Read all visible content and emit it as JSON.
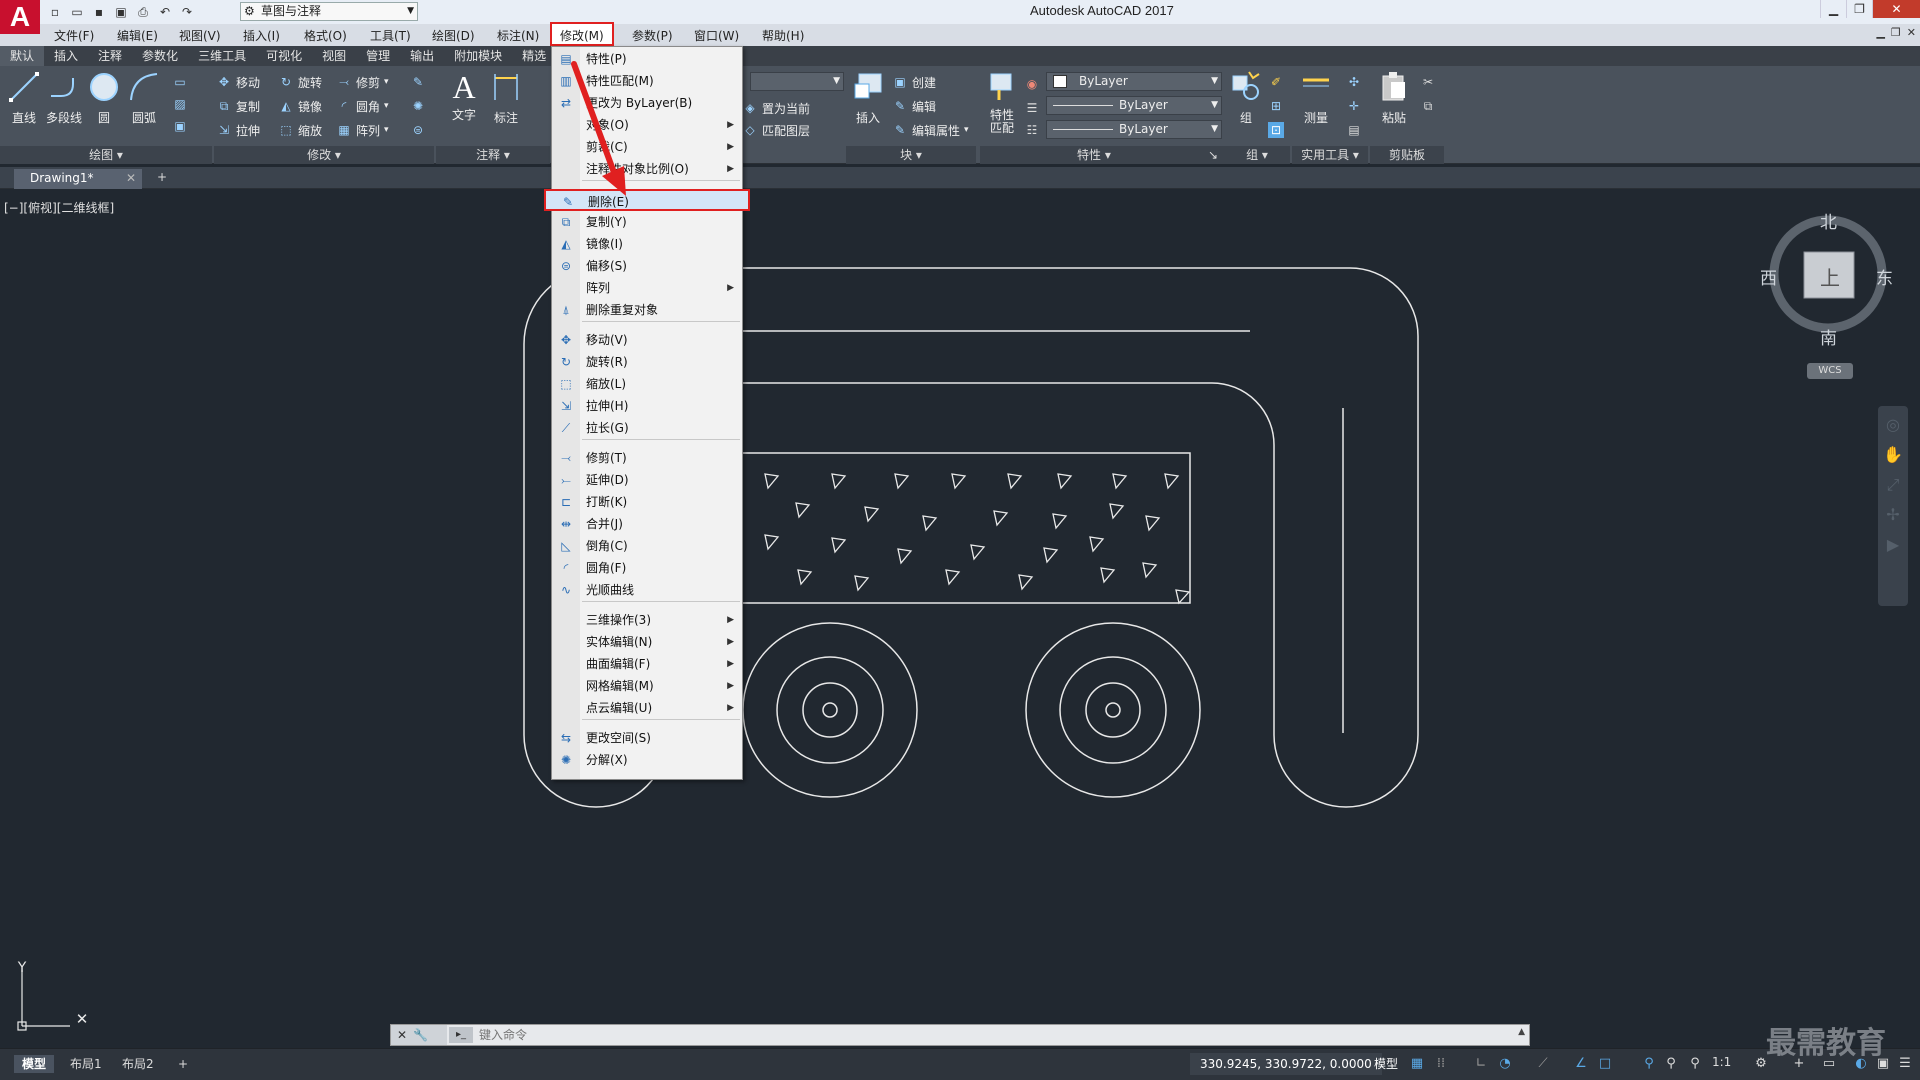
{
  "titlebar": {
    "app_title": "Autodesk AutoCAD 2017",
    "workspace": "草图与注释",
    "logo": "A"
  },
  "menubar": {
    "items": [
      "文件(F)",
      "编辑(E)",
      "视图(V)",
      "插入(I)",
      "格式(O)",
      "工具(T)",
      "绘图(D)",
      "标注(N)",
      "修改(M)",
      "参数(P)",
      "窗口(W)",
      "帮助(H)"
    ]
  },
  "ribbon_tabs": [
    "默认",
    "插入",
    "注释",
    "参数化",
    "三维工具",
    "可视化",
    "视图",
    "管理",
    "输出",
    "附加模块",
    "精选"
  ],
  "ribbon": {
    "draw": {
      "line": "直线",
      "polyline": "多段线",
      "circle": "圆",
      "arc": "圆弧",
      "title": "绘图"
    },
    "modify": {
      "move": "移动",
      "rotate": "旋转",
      "trim": "修剪",
      "copy": "复制",
      "mirror": "镜像",
      "fillet": "圆角",
      "stretch": "拉伸",
      "scale": "缩放",
      "array": "阵列",
      "title": "修改"
    },
    "annotation": {
      "text": "文字",
      "dimension": "标注",
      "title": "注释"
    },
    "layers": {
      "set_current": "置为当前",
      "match_layer": "匹配图层"
    },
    "block": {
      "insert": "插入",
      "create": "创建",
      "edit": "编辑",
      "edit_attr": "编辑属性",
      "title": "块"
    },
    "properties": {
      "match": "特性\n匹配",
      "color": "ByLayer",
      "linetype": "ByLayer",
      "lineweight": "ByLayer",
      "title": "特性"
    },
    "groups": {
      "group": "组",
      "title": "组"
    },
    "utilities": {
      "measure": "测量",
      "title": "实用工具"
    },
    "clipboard": {
      "paste": "粘贴",
      "title": "剪贴板"
    }
  },
  "doc_tab": {
    "name": "Drawing1*"
  },
  "viewport_label": "[−][俯视][二维线框]",
  "viewcube": {
    "north": "北",
    "south": "南",
    "east": "东",
    "west": "西",
    "top": "上",
    "wcs": "WCS"
  },
  "modify_menu": {
    "items": [
      {
        "label": "特性(P)",
        "icon": "properties-icon"
      },
      {
        "label": "特性匹配(M)",
        "icon": "match-properties-icon"
      },
      {
        "label": "更改为 ByLayer(B)",
        "icon": "bylayer-icon"
      },
      {
        "label": "对象(O)",
        "submenu": true
      },
      {
        "label": "剪裁(C)",
        "submenu": true
      },
      {
        "label": "注释性对象比例(O)",
        "submenu": true
      },
      {
        "label": "删除(E)",
        "icon": "erase-icon"
      },
      {
        "label": "复制(Y)",
        "icon": "copy-icon"
      },
      {
        "label": "镜像(I)",
        "icon": "mirror-icon"
      },
      {
        "label": "偏移(S)",
        "icon": "offset-icon"
      },
      {
        "label": "阵列",
        "submenu": true
      },
      {
        "label": "删除重复对象",
        "icon": "overkill-icon"
      },
      {
        "label": "移动(V)",
        "icon": "move-icon"
      },
      {
        "label": "旋转(R)",
        "icon": "rotate-icon"
      },
      {
        "label": "缩放(L)",
        "icon": "scale-icon"
      },
      {
        "label": "拉伸(H)",
        "icon": "stretch-icon"
      },
      {
        "label": "拉长(G)",
        "icon": "lengthen-icon"
      },
      {
        "label": "修剪(T)",
        "icon": "trim-icon"
      },
      {
        "label": "延伸(D)",
        "icon": "extend-icon"
      },
      {
        "label": "打断(K)",
        "icon": "break-icon"
      },
      {
        "label": "合并(J)",
        "icon": "join-icon"
      },
      {
        "label": "倒角(C)",
        "icon": "chamfer-icon"
      },
      {
        "label": "圆角(F)",
        "icon": "fillet-icon"
      },
      {
        "label": "光顺曲线",
        "icon": "blend-icon"
      },
      {
        "label": "三维操作(3)",
        "submenu": true
      },
      {
        "label": "实体编辑(N)",
        "submenu": true
      },
      {
        "label": "曲面编辑(F)",
        "submenu": true
      },
      {
        "label": "网格编辑(M)",
        "submenu": true
      },
      {
        "label": "点云编辑(U)",
        "submenu": true
      },
      {
        "label": "更改空间(S)",
        "icon": "change-space-icon"
      },
      {
        "label": "分解(X)",
        "icon": "explode-icon"
      }
    ],
    "highlighted": "删除(E)"
  },
  "command_line": {
    "placeholder": "键入命令"
  },
  "statusbar": {
    "layouts": [
      "模型",
      "布局1",
      "布局2"
    ],
    "coords": "330.9245, 330.9722, 0.0000",
    "model": "模型",
    "scale": "1:1"
  },
  "watermark": "最需教育",
  "accent_colors": {
    "highlight_border": "#e02020",
    "canvas_bg": "#212830",
    "logo_red": "#c8102e"
  }
}
